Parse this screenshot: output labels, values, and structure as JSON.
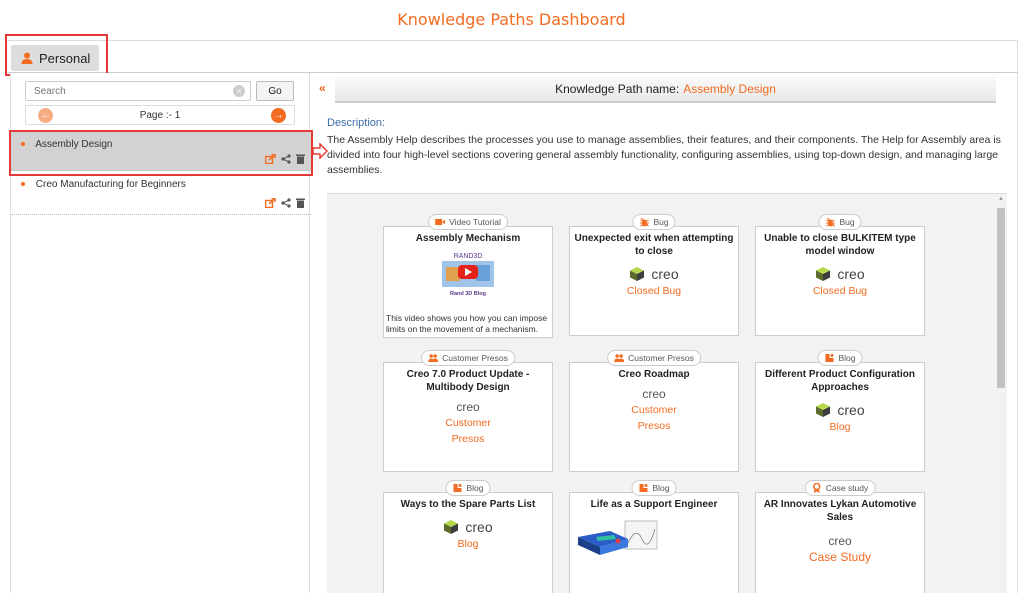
{
  "page": {
    "title": "Knowledge Paths Dashboard"
  },
  "tabs": [
    {
      "label": "Personal",
      "icon": "user-icon",
      "active": true
    }
  ],
  "left": {
    "search": {
      "placeholder": "Search",
      "value": ""
    },
    "go_label": "Go",
    "pager": {
      "label": "Page :- 1"
    },
    "paths": [
      {
        "label": "Assembly Design",
        "selected": true
      },
      {
        "label": "Creo Manufacturing for Beginners",
        "selected": false
      }
    ]
  },
  "right": {
    "header_prefix": "Knowledge Path name:",
    "header_name": "Assembly Design",
    "description_label": "Description:",
    "description": "The Assembly Help describes the processes you use to manage assemblies, their features, and their components. The Help for Assembly area is divided into four high-level sections covering general assembly functionality, configuring assemblies, using top-down design, and managing large assemblies."
  },
  "cards": [
    {
      "badge": "Video Tutorial",
      "badge_icon": "video-icon",
      "title": "Assembly Mechanism",
      "thumb_brand": "RAND3D",
      "thumb_caption": "Rand 3D Blog",
      "desc": "This video shows you how you can impose limits on the movement of a mechanism."
    },
    {
      "badge": "Bug",
      "badge_icon": "bug-icon",
      "title": "Unexpected exit when attempting to close",
      "logo": "creo",
      "sub": "Closed Bug"
    },
    {
      "badge": "Bug",
      "badge_icon": "bug-icon",
      "title": "Unable to close BULKITEM type model window",
      "logo": "creo",
      "sub": "Closed Bug"
    },
    {
      "badge": "Customer Presos",
      "badge_icon": "people-icon",
      "title": "Creo 7.0 Product Update - Multibody Design",
      "logo": "creo",
      "sub1": "Customer",
      "sub2": "Presos"
    },
    {
      "badge": "Customer Presos",
      "badge_icon": "people-icon",
      "title": "Creo Roadmap",
      "logo": "creo",
      "sub1": "Customer",
      "sub2": "Presos"
    },
    {
      "badge": "Blog",
      "badge_icon": "blog-icon",
      "title": "Different Product Configuration Approaches",
      "logo": "creo",
      "sub": "Blog"
    },
    {
      "badge": "Blog",
      "badge_icon": "blog-icon",
      "title": "Ways to the Spare Parts List",
      "logo": "creo",
      "sub": "Blog"
    },
    {
      "badge": "Blog",
      "badge_icon": "blog-icon",
      "title": "Life as a Support Engineer"
    },
    {
      "badge": "Case study",
      "badge_icon": "award-icon",
      "title": "AR Innovates Lykan Automotive Sales",
      "logo": "creo",
      "sub": "Case Study"
    }
  ],
  "colors": {
    "accent": "#f26b21",
    "highlight": "#e53935",
    "desc_label": "#3b6ea5"
  }
}
